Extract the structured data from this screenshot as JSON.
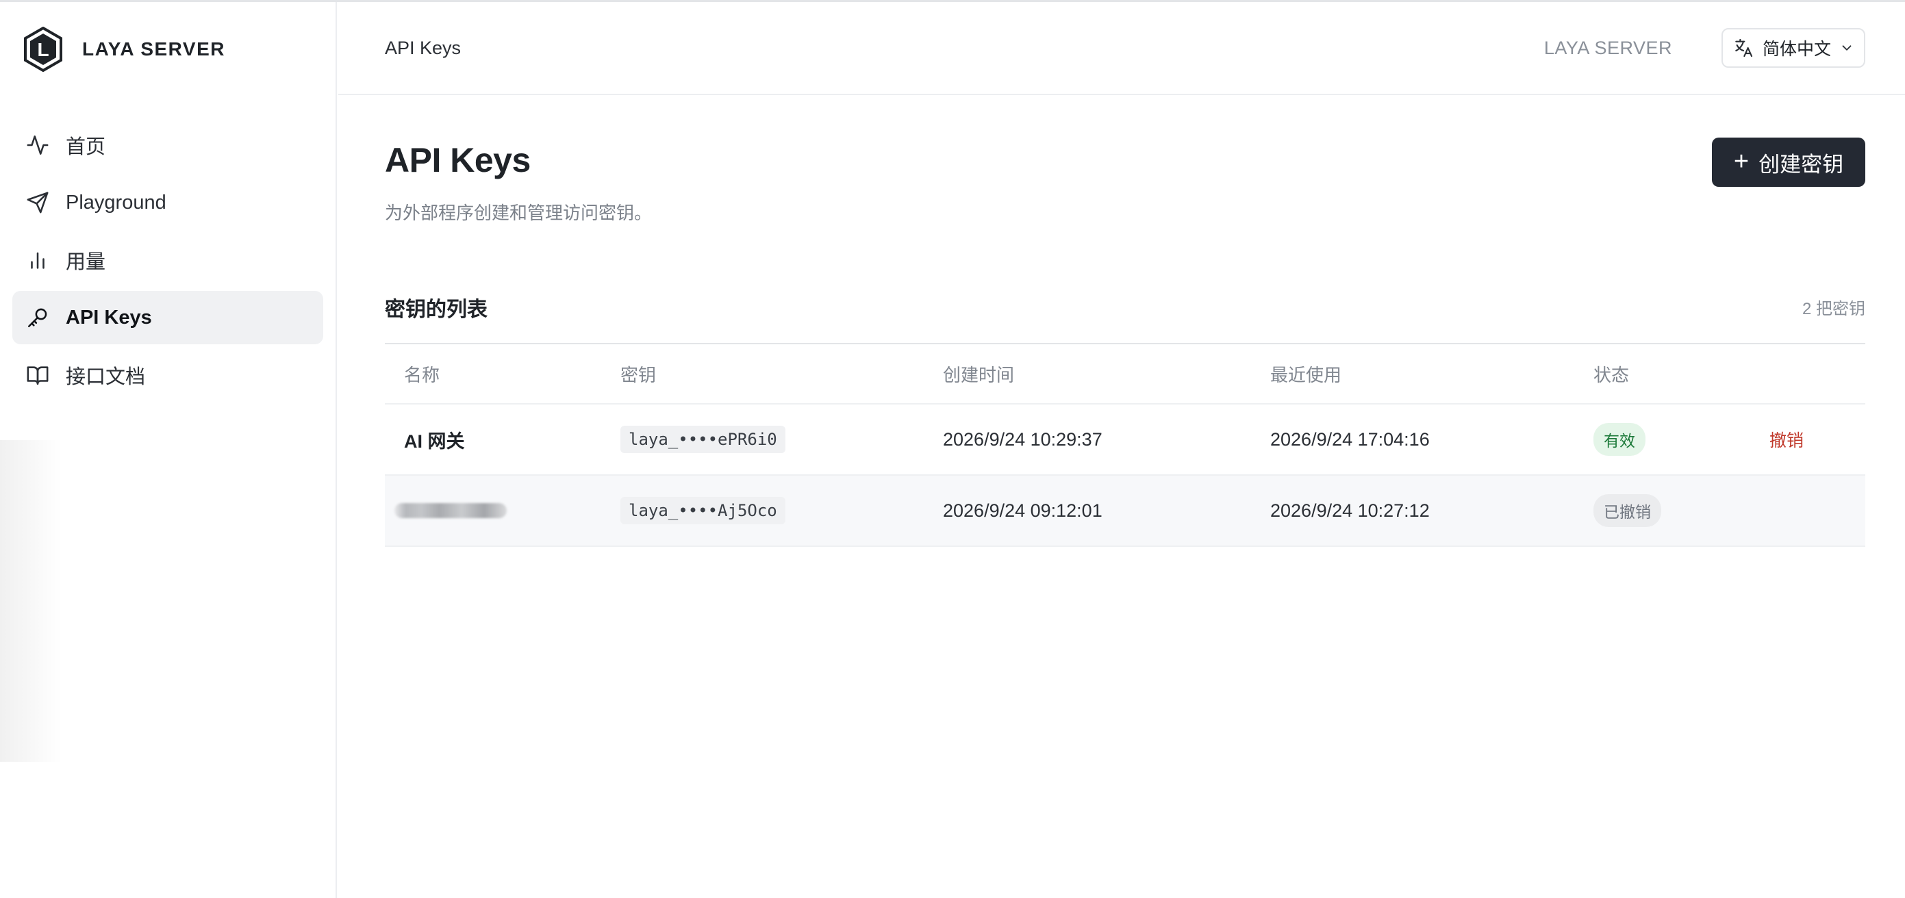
{
  "app": {
    "brand_name": "LAYA SERVER",
    "logo_letter": "L"
  },
  "sidebar": {
    "items": [
      {
        "label": "首页",
        "icon": "activity-icon",
        "active": false
      },
      {
        "label": "Playground",
        "icon": "send-icon",
        "active": false
      },
      {
        "label": "用量",
        "icon": "bar-chart-icon",
        "active": false
      },
      {
        "label": "API Keys",
        "icon": "key-icon",
        "active": true
      },
      {
        "label": "接口文档",
        "icon": "book-icon",
        "active": false
      }
    ]
  },
  "header": {
    "breadcrumb": "API Keys",
    "brand": "LAYA SERVER",
    "language": {
      "selected": "简体中文",
      "icon": "translate-icon"
    }
  },
  "main": {
    "title": "API Keys",
    "subtitle": "为外部程序创建和管理访问密钥。",
    "create_button": {
      "icon": "+",
      "label": "创建密钥"
    },
    "list": {
      "title": "密钥的列表",
      "count": "2 把密钥",
      "columns": [
        "名称",
        "密钥",
        "创建时间",
        "最近使用",
        "状态"
      ],
      "rows": [
        {
          "name": "AI 网关",
          "key": "laya_••••ePR6i0",
          "created": "2026/9/24 10:29:37",
          "last_used": "2026/9/24 17:04:16",
          "status": "有效",
          "action": "撤销"
        },
        {
          "name": "",
          "key": "laya_••••Aj5Oco",
          "created": "2026/9/24 09:12:01",
          "last_used": "2026/9/24 10:27:12",
          "status": "已撤销",
          "action": ""
        }
      ]
    }
  },
  "colors": {
    "primary_button": "#242933",
    "active_nav_bg": "#f0f1f3",
    "status_valid_bg": "#e4f5e8",
    "status_valid_text": "#1d7a3a",
    "status_revoked_bg": "#ebecee",
    "revoke_text": "#c0392b"
  }
}
